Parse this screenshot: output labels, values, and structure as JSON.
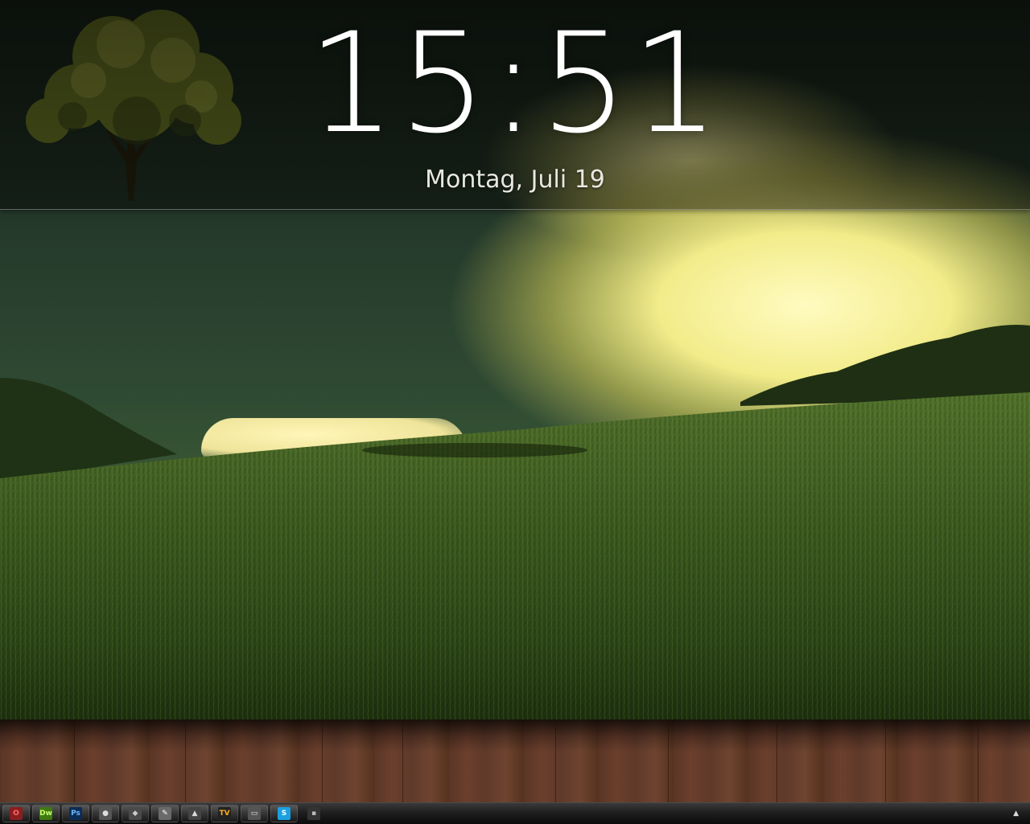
{
  "clock": {
    "time": "15:51",
    "date": "Montag, Juli 19"
  },
  "taskbar": {
    "items": [
      {
        "name": "opera-icon",
        "glyph": "O",
        "bg": "#8a1e1e",
        "fg": "#ff6a6a"
      },
      {
        "name": "dreamweaver-icon",
        "glyph": "Dw",
        "bg": "#3f7a12",
        "fg": "#c8ff6a"
      },
      {
        "name": "photoshop-icon",
        "glyph": "Ps",
        "bg": "#0c2c55",
        "fg": "#6ab8ff"
      },
      {
        "name": "app-icon",
        "glyph": "●",
        "bg": "#555555",
        "fg": "#dddddd"
      },
      {
        "name": "media-icon",
        "glyph": "◆",
        "bg": "#4a4a4a",
        "fg": "#cccccc"
      },
      {
        "name": "notepad-icon",
        "glyph": "✎",
        "bg": "#6a6a6a",
        "fg": "#ffffff"
      },
      {
        "name": "launcher-icon",
        "glyph": "▲",
        "bg": "#444444",
        "fg": "#dddddd"
      },
      {
        "name": "tv-icon",
        "glyph": "TV",
        "bg": "#222222",
        "fg": "#ffb020"
      },
      {
        "name": "computer-icon",
        "glyph": "▭",
        "bg": "#555555",
        "fg": "#eeeeee"
      },
      {
        "name": "skype-icon",
        "glyph": "S",
        "bg": "#1aa0e0",
        "fg": "#ffffff"
      },
      {
        "name": "terminal-icon",
        "glyph": "▪",
        "bg": "#333333",
        "fg": "#bbbbbb"
      }
    ],
    "tray_glyph": "▲"
  }
}
